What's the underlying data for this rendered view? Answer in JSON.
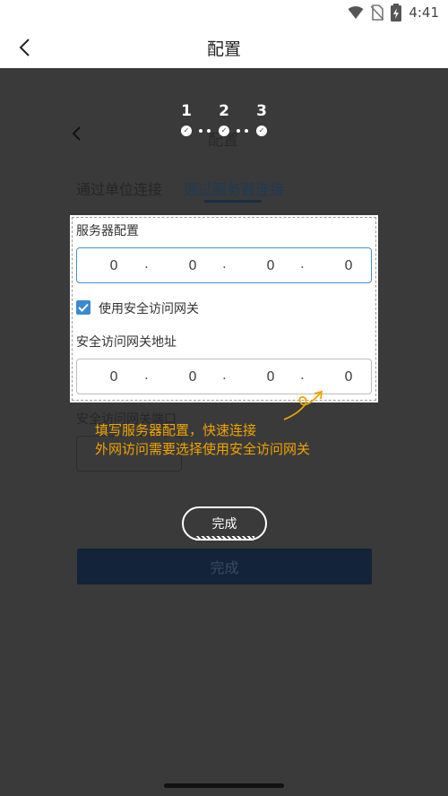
{
  "status_bar": {
    "time": "4:41",
    "icons": [
      "wifi-icon",
      "no-sim-icon",
      "battery-charging-icon"
    ]
  },
  "header": {
    "title": "配置",
    "back_icon": "chevron-left-icon"
  },
  "dimmed_page": {
    "title": "配置",
    "tabs": [
      {
        "label": "通过单位连接",
        "active": false
      },
      {
        "label": "通过服务器连接",
        "active": true
      }
    ],
    "port_label": "安全访问网关端口",
    "done_label": "完成"
  },
  "guide": {
    "steps": [
      "1",
      "2",
      "3"
    ],
    "current_step": 2,
    "server_section": {
      "label": "服务器配置",
      "ip": [
        "0",
        "0",
        "0",
        "0"
      ]
    },
    "gateway_checkbox": {
      "label": "使用安全访问网关",
      "checked": true
    },
    "gateway_section": {
      "label": "安全访问网关地址",
      "ip": [
        "0",
        "0",
        "0",
        "0"
      ]
    },
    "tip_lines": [
      "填写服务器配置，快速连接",
      "外网访问需要选择使用安全访问网关"
    ],
    "complete_button": "完成"
  },
  "colors": {
    "overlay": "#3a3a3a",
    "tip": "#f0a300",
    "accent": "#3a8ad0",
    "dimmed_button": "#13233a"
  }
}
